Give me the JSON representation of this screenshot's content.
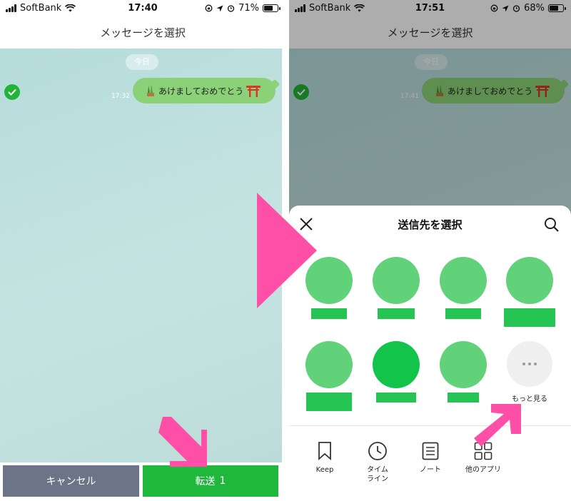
{
  "left": {
    "status": {
      "carrier": "SoftBank",
      "time": "17:40",
      "battery": "71%",
      "battery_level": 0.71
    },
    "title": "メッセージを選択",
    "date_pill": "今日",
    "message": {
      "time": "17:32",
      "text": "あけましておめでとう"
    },
    "buttons": {
      "cancel": "キャンセル",
      "forward": "転送",
      "forward_count": "1"
    }
  },
  "right": {
    "status": {
      "carrier": "SoftBank",
      "time": "17:51",
      "battery": "68%",
      "battery_level": 0.68
    },
    "title": "メッセージを選択",
    "date_pill": "今日",
    "message": {
      "time": "17:41",
      "text": "あけましておめでとう"
    },
    "sheet": {
      "title": "送信先を選択",
      "more_label": "もっと見る",
      "share_options": [
        {
          "label": "Keep",
          "icon": "bookmark-icon"
        },
        {
          "label": "タイム\nライン",
          "icon": "clock-icon"
        },
        {
          "label": "ノート",
          "icon": "note-icon"
        },
        {
          "label": "他のアプリ",
          "icon": "apps-icon"
        }
      ]
    }
  },
  "colors": {
    "accent_green": "#1fb83c",
    "highlight_pink": "#ff4fa7",
    "cancel_gray": "#6c7488",
    "chat_bg": "#bfe0df"
  }
}
